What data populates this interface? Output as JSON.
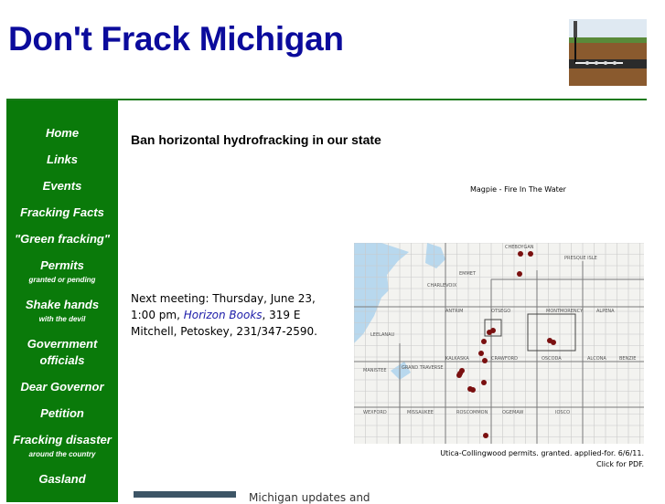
{
  "site": {
    "title": "Don't Frack Michigan"
  },
  "nav": [
    {
      "label": "Home",
      "sub": ""
    },
    {
      "label": "Links",
      "sub": ""
    },
    {
      "label": "Events",
      "sub": ""
    },
    {
      "label": "Fracking Facts",
      "sub": ""
    },
    {
      "label": "\"Green fracking\"",
      "sub": ""
    },
    {
      "label": "Permits",
      "sub": "granted or pending"
    },
    {
      "label": "Shake hands",
      "sub": "with the devil"
    },
    {
      "label": "Government officials",
      "sub": ""
    },
    {
      "label": "Dear Governor",
      "sub": ""
    },
    {
      "label": "Petition",
      "sub": ""
    },
    {
      "label": "Fracking disaster",
      "sub": "around the country"
    },
    {
      "label": "Gasland",
      "sub": ""
    }
  ],
  "main": {
    "heading": "Ban horizontal hydrofracking in our state",
    "video_caption": "Magpie - Fire In The Water",
    "meeting": {
      "prefix": "Next meeting: Thursday, June 23, 1:00 pm, ",
      "link": "Horizon Books",
      "suffix": ", 319 E Mitchell, Petoskey, 231/347-2590."
    },
    "map": {
      "caption_line1": "Utica-Collingwood permits. granted. applied-for. 6/6/11.",
      "caption_line2": "Click for PDF.",
      "labels": [
        "CHEBOYGAN",
        "PRESQUE ISLE",
        "CHARLEVOIX",
        "EMMET",
        "ANTRIM",
        "OTSEGO",
        "MONTMORENCY",
        "ALPENA",
        "LEELANAU",
        "GRAND TRAVERSE",
        "KALKASKA",
        "CRAWFORD",
        "OSCODA",
        "ALCONA",
        "BENZIE",
        "MANISTEE",
        "WEXFORD",
        "MISSAUKEE",
        "ROSCOMMON",
        "OGEMAW",
        "IOSCO"
      ]
    },
    "bottom_text": "Michigan updates and"
  },
  "colors": {
    "title": "#0b0b9c",
    "sidebar": "#0a7a0a",
    "link": "#1a1aa8"
  }
}
